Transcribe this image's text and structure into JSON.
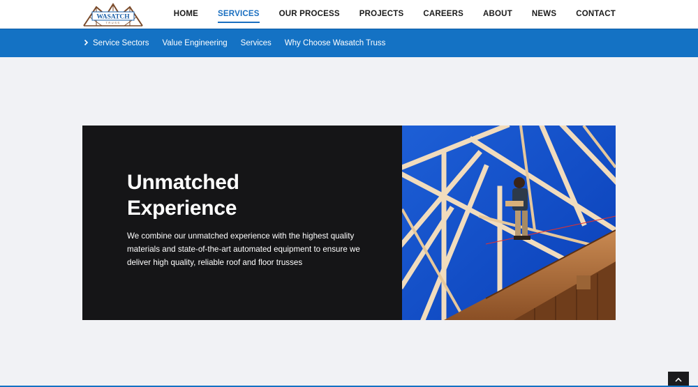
{
  "brand": {
    "logo_text": "WASATCH",
    "logo_subtext": "TRUSS",
    "logo_icon": "house-roof-truss-icon"
  },
  "nav": {
    "items": [
      {
        "label": "HOME",
        "active": false
      },
      {
        "label": "SERVICES",
        "active": true
      },
      {
        "label": "OUR PROCESS",
        "active": false
      },
      {
        "label": "PROJECTS",
        "active": false
      },
      {
        "label": "CAREERS",
        "active": false
      },
      {
        "label": "ABOUT",
        "active": false
      },
      {
        "label": "NEWS",
        "active": false
      },
      {
        "label": "CONTACT",
        "active": false
      }
    ]
  },
  "subnav": {
    "chevron_icon": "chevron-right-icon",
    "items": [
      {
        "label": "Service Sectors"
      },
      {
        "label": "Value Engineering"
      },
      {
        "label": "Services"
      },
      {
        "label": "Why Choose Wasatch Truss"
      }
    ]
  },
  "hero": {
    "title_line1": "Unmatched",
    "title_line2": "Experience",
    "body": "We combine our unmatched experience with the highest quality materials and state-of-the-art automated equipment to ensure we deliver high quality, reliable roof and floor trusses"
  },
  "back_to_top": {
    "icon": "chevron-up-icon"
  },
  "colors": {
    "accent": "#1472c4",
    "card_bg": "#151517",
    "page_bg": "#f1f2f5",
    "nav_active": "#1a6fc0"
  }
}
